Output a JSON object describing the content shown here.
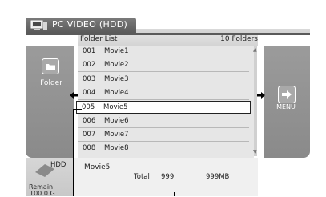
{
  "header": {
    "title": "PC VIDEO (HDD)",
    "icon": "pc-monitor-icon"
  },
  "list": {
    "title": "Folder List",
    "count_label": "10 Folders",
    "items": [
      {
        "num": "001",
        "name": "Movie1"
      },
      {
        "num": "002",
        "name": "Movie2"
      },
      {
        "num": "003",
        "name": "Movie3"
      },
      {
        "num": "004",
        "name": "Movie4"
      },
      {
        "num": "005",
        "name": "Movie5"
      },
      {
        "num": "006",
        "name": "Movie6"
      },
      {
        "num": "007",
        "name": "Movie7"
      },
      {
        "num": "008",
        "name": "Movie8"
      }
    ],
    "selected_index": 4
  },
  "left_panel": {
    "label": "Folder",
    "icon": "folder-icon"
  },
  "right_panel": {
    "label": "MENU",
    "icon": "menu-arrow-icon"
  },
  "storage": {
    "device": "HDD",
    "remain_label": "Remain",
    "remain_value": "100.0 G"
  },
  "info": {
    "name": "Movie5",
    "total_label": "Total",
    "total_count": "999",
    "total_size": "999MB"
  },
  "colors": {
    "panel_grey": "#8f8f8f",
    "title_bar": "#5a5a5a",
    "list_bg": "#e6e6e6",
    "selected_bg": "#ffffff"
  }
}
